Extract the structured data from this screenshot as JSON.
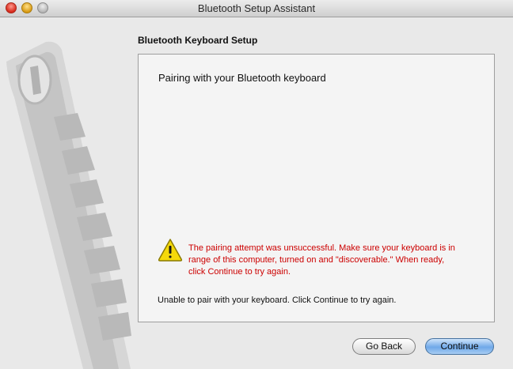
{
  "window": {
    "title": "Bluetooth Setup Assistant"
  },
  "page": {
    "heading": "Bluetooth Keyboard Setup"
  },
  "panel": {
    "title": "Pairing with your Bluetooth keyboard",
    "warning_line1": "The pairing attempt was unsuccessful. Make sure your keyboard is in",
    "warning_line2": "range of this computer, turned on and \"discoverable.\" When ready,",
    "warning_line3": "click Continue to try again.",
    "status": "Unable to pair with your keyboard. Click Continue to try again."
  },
  "buttons": {
    "back": "Go Back",
    "continue": "Continue"
  },
  "icons": {
    "warning": "warning-icon",
    "art": "bluetooth-keyboard-illustration"
  },
  "colors": {
    "warning_text": "#cc0000",
    "default_button": "#6fa8e8"
  }
}
